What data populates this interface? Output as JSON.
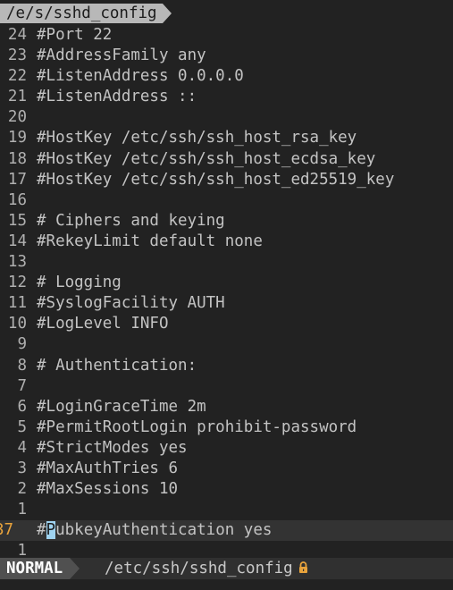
{
  "tabline": {
    "active_tab": "/e/s/sshd_config"
  },
  "buffer": {
    "lines": [
      {
        "num": "24",
        "text": "#Port 22"
      },
      {
        "num": "23",
        "text": "#AddressFamily any"
      },
      {
        "num": "22",
        "text": "#ListenAddress 0.0.0.0"
      },
      {
        "num": "21",
        "text": "#ListenAddress ::"
      },
      {
        "num": "20",
        "text": ""
      },
      {
        "num": "19",
        "text": "#HostKey /etc/ssh/ssh_host_rsa_key"
      },
      {
        "num": "18",
        "text": "#HostKey /etc/ssh/ssh_host_ecdsa_key"
      },
      {
        "num": "17",
        "text": "#HostKey /etc/ssh/ssh_host_ed25519_key"
      },
      {
        "num": "16",
        "text": ""
      },
      {
        "num": "15",
        "text": "# Ciphers and keying"
      },
      {
        "num": "14",
        "text": "#RekeyLimit default none"
      },
      {
        "num": "13",
        "text": ""
      },
      {
        "num": "12",
        "text": "# Logging"
      },
      {
        "num": "11",
        "text": "#SyslogFacility AUTH"
      },
      {
        "num": "10",
        "text": "#LogLevel INFO"
      },
      {
        "num": "9",
        "text": ""
      },
      {
        "num": "8",
        "text": "# Authentication:"
      },
      {
        "num": "7",
        "text": ""
      },
      {
        "num": "6",
        "text": "#LoginGraceTime 2m"
      },
      {
        "num": "5",
        "text": "#PermitRootLogin prohibit-password"
      },
      {
        "num": "4",
        "text": "#StrictModes yes"
      },
      {
        "num": "3",
        "text": "#MaxAuthTries 6"
      },
      {
        "num": "2",
        "text": "#MaxSessions 10"
      },
      {
        "num": "1",
        "text": ""
      }
    ],
    "current_line": {
      "num": "37",
      "before_cursor": "#",
      "cursor_char": "P",
      "after_cursor": "ubkeyAuthentication yes"
    },
    "after_lines": [
      {
        "num": "1",
        "text": ""
      }
    ]
  },
  "statusline": {
    "mode": "NORMAL",
    "file": "/etc/ssh/sshd_config",
    "readonly_icon": "lock-icon"
  },
  "colors": {
    "background": "#222222",
    "current_line_number": "#e8a33c",
    "cursor": "#9fd3f0",
    "lock": "#e8a33c"
  }
}
